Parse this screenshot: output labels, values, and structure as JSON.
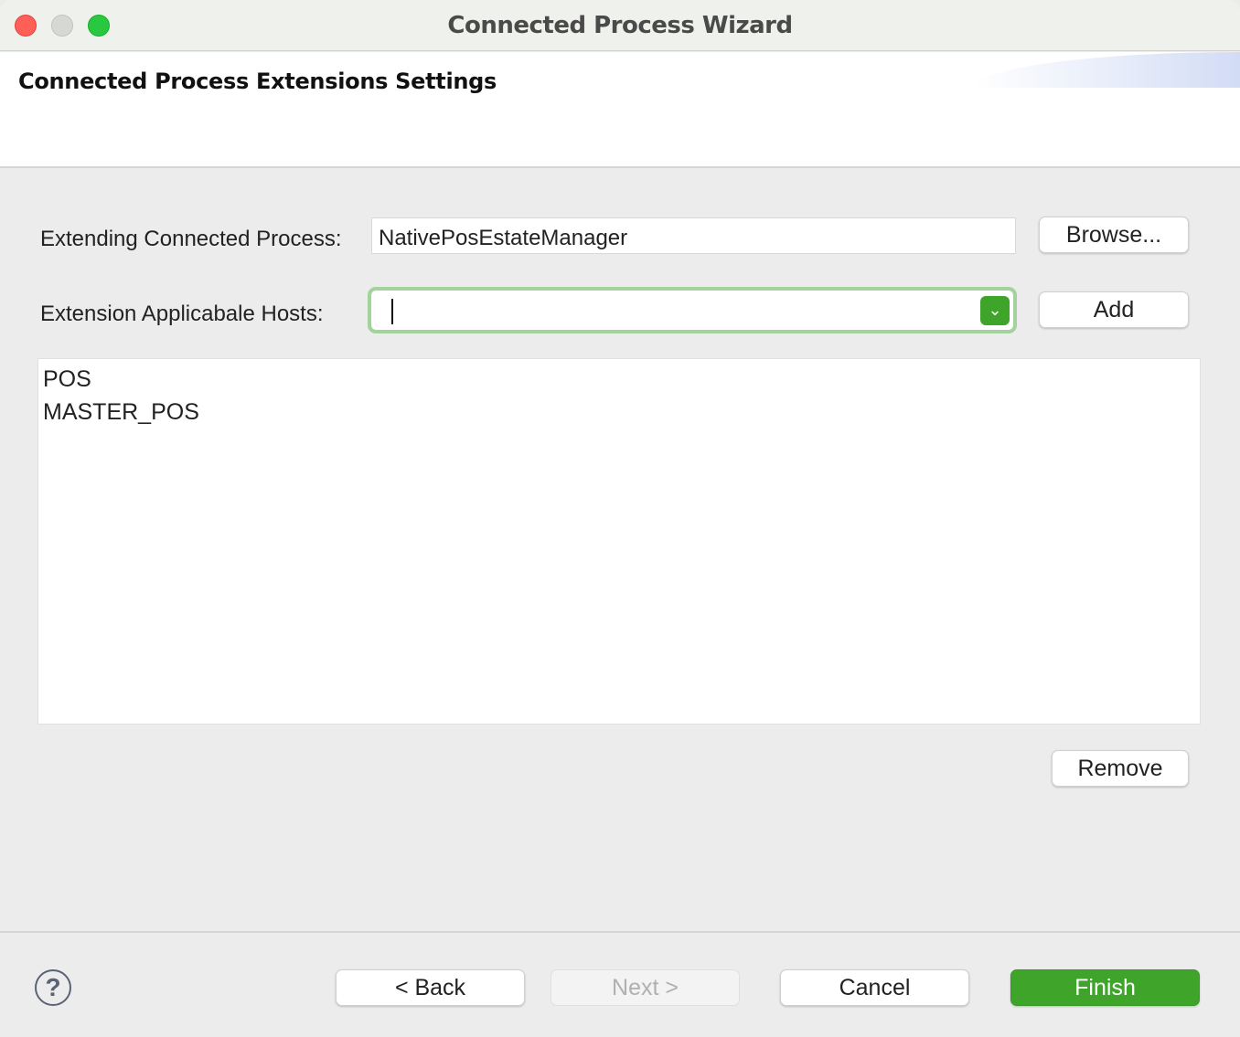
{
  "window": {
    "title": "Connected Process Wizard"
  },
  "header": {
    "title": "Connected Process Extensions Settings"
  },
  "form": {
    "process_label": "Extending Connected Process:",
    "process_value": "NativePosEstateManager",
    "browse_label": "Browse...",
    "hosts_label": "Extension Applicabale Hosts:",
    "hosts_value": "",
    "add_label": "Add",
    "hosts_list": [
      "POS",
      "MASTER_POS"
    ],
    "remove_label": "Remove"
  },
  "footer": {
    "back": "< Back",
    "next": "Next >",
    "cancel": "Cancel",
    "finish": "Finish",
    "help_icon": "question-circle-icon"
  },
  "colors": {
    "accent": "#3fa52a",
    "focus_ring": "#a4d29c"
  }
}
